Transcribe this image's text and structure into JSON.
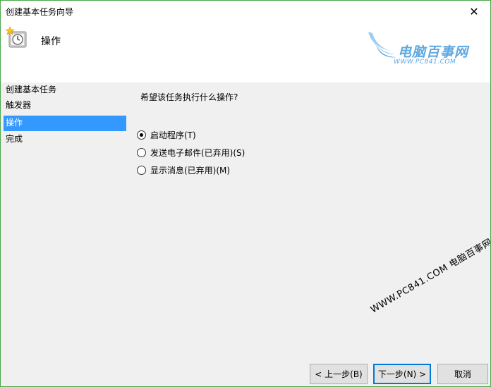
{
  "window": {
    "title": "创建基本任务向导",
    "close_glyph": "✕",
    "accent_color": "#3399ff"
  },
  "header": {
    "title": "操作",
    "icon": "task-clock-icon"
  },
  "logo": {
    "main": "电脑百事网",
    "sub": "WWW.PC841.COM"
  },
  "sidebar": {
    "items": [
      {
        "label": "创建基本任务",
        "active": false
      },
      {
        "label": "触发器",
        "active": false
      },
      {
        "label": "操作",
        "active": true
      },
      {
        "label": "完成",
        "active": false
      }
    ]
  },
  "main": {
    "question": "希望该任务执行什么操作?",
    "options": [
      {
        "label": "启动程序(T)",
        "checked": true
      },
      {
        "label": "发送电子邮件(已弃用)(S)",
        "checked": false
      },
      {
        "label": "显示消息(已弃用)(M)",
        "checked": false
      }
    ]
  },
  "watermark": "WWW.PC841.COM 电脑百事网",
  "footer": {
    "back_label": "< 上一步(B)",
    "next_label": "下一步(N) >",
    "cancel_label": "取消"
  }
}
